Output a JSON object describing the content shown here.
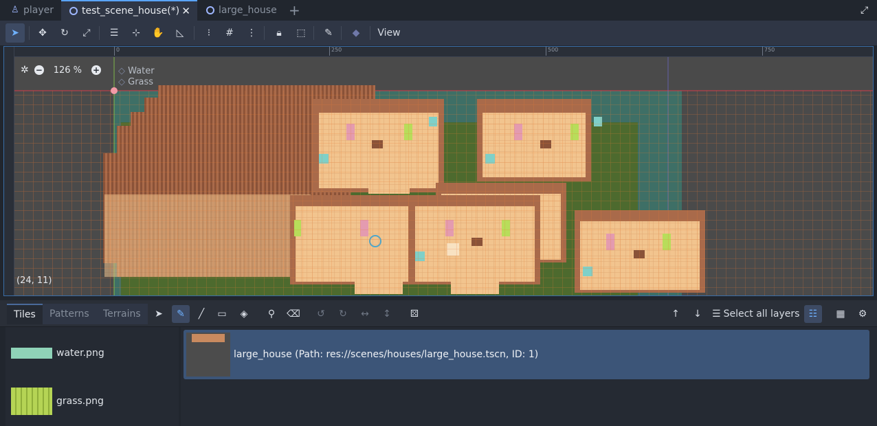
{
  "tabs": [
    {
      "label": "player",
      "icon": "player-scene-icon",
      "active": false
    },
    {
      "label": "test_scene_house(*)",
      "icon": "scene-ring-icon",
      "active": true
    },
    {
      "label": "large_house",
      "icon": "scene-ring-icon",
      "active": false
    }
  ],
  "toolbar": {
    "view_label": "View"
  },
  "viewport": {
    "zoom_label": "126 %",
    "layers": [
      "Water",
      "Grass"
    ],
    "coords": "(24, 11)",
    "ruler_ticks": [
      "0",
      "250",
      "500",
      "750"
    ]
  },
  "bottom": {
    "tabs": [
      "Tiles",
      "Patterns",
      "Terrains"
    ],
    "select_layers_label": "Select all layers"
  },
  "sources": [
    {
      "label": "water.png",
      "swatch_color": "#8fd3b8"
    },
    {
      "label": "grass.png",
      "swatch_color": "#b5d455"
    }
  ],
  "scene_item": {
    "label": "large_house (Path: res://scenes/houses/large_house.tscn, ID: 1)"
  },
  "colors": {
    "accent": "#5aa4ff",
    "selection": "#3c5578",
    "grid_orange": "#e77a35"
  }
}
